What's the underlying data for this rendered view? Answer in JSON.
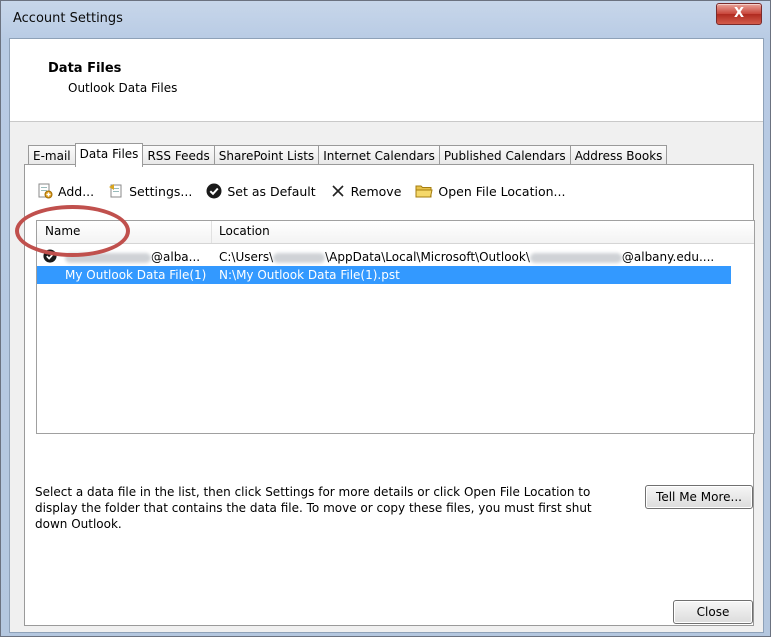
{
  "window": {
    "title": "Account Settings",
    "close_glyph": "X"
  },
  "header": {
    "title": "Data Files",
    "subtitle": "Outlook Data Files"
  },
  "tabs": [
    {
      "label": "E-mail",
      "active": false
    },
    {
      "label": "Data Files",
      "active": true
    },
    {
      "label": "RSS Feeds",
      "active": false
    },
    {
      "label": "SharePoint Lists",
      "active": false
    },
    {
      "label": "Internet Calendars",
      "active": false
    },
    {
      "label": "Published Calendars",
      "active": false
    },
    {
      "label": "Address Books",
      "active": false
    }
  ],
  "toolbar": {
    "add": "Add...",
    "settings": "Settings...",
    "set_default": "Set as Default",
    "remove": "Remove",
    "open_location": "Open File Location..."
  },
  "list": {
    "columns": [
      "Name",
      "Location"
    ],
    "rows": [
      {
        "name_suffix": "@alba...",
        "location_prefix": "C:\\Users\\",
        "location_mid": "\\AppData\\Local\\Microsoft\\Outlook\\",
        "location_suffix": "@albany.edu....",
        "default": true,
        "selected": false
      },
      {
        "name": "My Outlook Data File(1)",
        "location": "N:\\My Outlook Data File(1).pst",
        "default": false,
        "selected": true
      }
    ]
  },
  "help_text": "Select a data file in the list, then click Settings for more details or click Open File Location to display the folder that contains the data file. To move or copy these files, you must first shut down Outlook.",
  "buttons": {
    "tell_me_more": "Tell Me More...",
    "close": "Close"
  },
  "colors": {
    "selection": "#3399ff",
    "highlight_oval": "#c0504d"
  }
}
